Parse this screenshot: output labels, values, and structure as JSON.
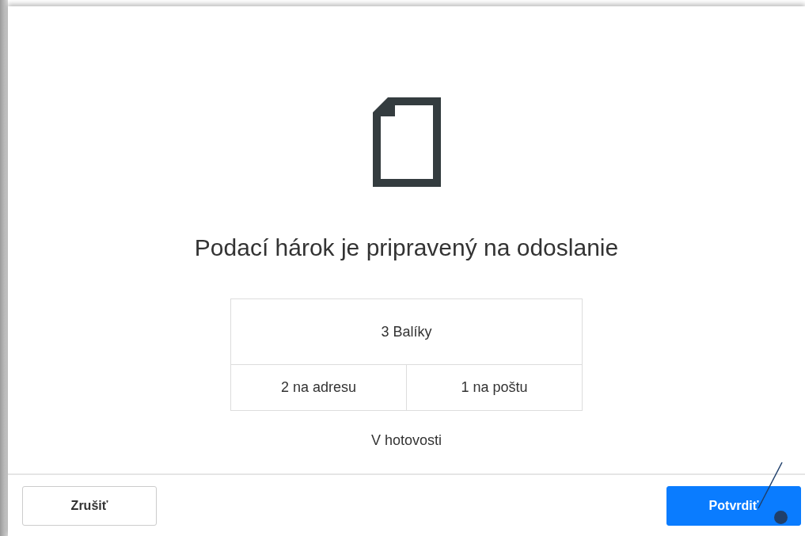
{
  "dialog": {
    "title": "Podací hárok je pripravený na odoslanie",
    "summary": {
      "total": "3 Balíky",
      "parts": [
        "2 na adresu",
        "1 na poštu"
      ]
    },
    "payment": "V hotovosti",
    "buttons": [
      {
        "label": "Zrušiť",
        "kind": "secondary"
      },
      {
        "label": "Potvrdiť",
        "kind": "primary"
      }
    ]
  }
}
